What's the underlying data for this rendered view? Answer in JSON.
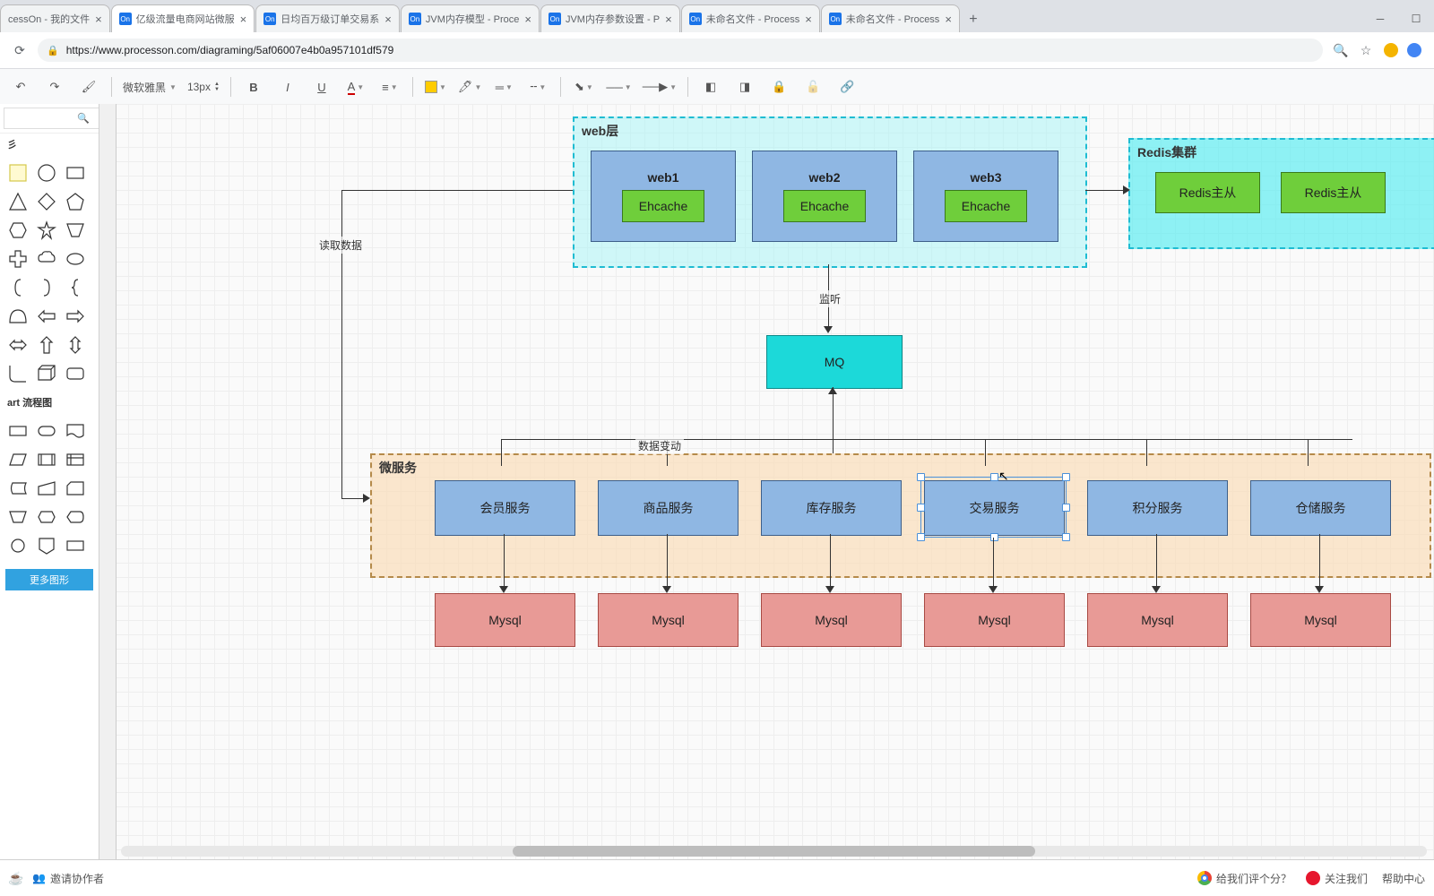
{
  "browser": {
    "tabs": [
      {
        "icon": "",
        "title": "cessOn - 我的文件"
      },
      {
        "icon": "On",
        "title": "亿级流量电商网站微服"
      },
      {
        "icon": "On",
        "title": "日均百万级订单交易系"
      },
      {
        "icon": "On",
        "title": "JVM内存模型 - Proce"
      },
      {
        "icon": "On",
        "title": "JVM内存参数设置 - P"
      },
      {
        "icon": "On",
        "title": "未命名文件 - Process"
      },
      {
        "icon": "On",
        "title": "未命名文件 - Process"
      }
    ],
    "active_tab": 1,
    "url": "https://www.processon.com/diagraming/5af06007e4b0a957101df579",
    "new_tab": "+"
  },
  "toolbar": {
    "font_family": "微软雅黑",
    "font_size": "13px",
    "bold": "B",
    "italic": "I",
    "underline": "U"
  },
  "shape_panel": {
    "search_placeholder": "",
    "section_shapes": "彡",
    "section_flowchart": "art 流程图",
    "more_shapes": "更多图形"
  },
  "diagram": {
    "web_layer": {
      "title": "web层"
    },
    "web_nodes": [
      {
        "title": "web1",
        "cache": "Ehcache"
      },
      {
        "title": "web2",
        "cache": "Ehcache"
      },
      {
        "title": "web3",
        "cache": "Ehcache"
      }
    ],
    "redis_cluster": {
      "title": "Redis集群",
      "primary": "Redis主从",
      "replica": "Redis主从"
    },
    "read_data_label": "读取数据",
    "listen_label": "监听",
    "mq": "MQ",
    "data_change_label": "数据变动",
    "microservice_title": "微服务",
    "services": [
      "会员服务",
      "商品服务",
      "库存服务",
      "交易服务",
      "积分服务",
      "仓储服务"
    ],
    "mysql": "Mysql",
    "selected_service_index": 3
  },
  "footer": {
    "invite": "邀请协作者",
    "rate": "给我们评个分？",
    "follow": "关注我们",
    "help": "帮助中心"
  }
}
